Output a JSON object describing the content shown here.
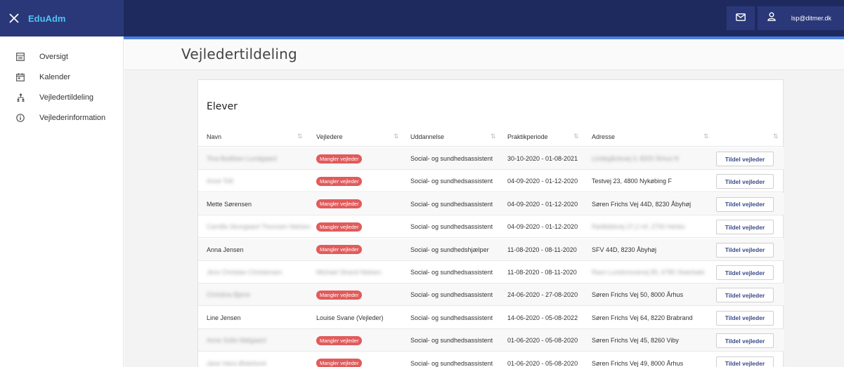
{
  "app": {
    "brand": "EduAdm",
    "user_email": "lsp@ditmer.dk"
  },
  "icons": {
    "close": "close-icon",
    "mail": "mail-icon",
    "user": "user-icon"
  },
  "colors": {
    "topbar": "#1e2a5e",
    "accent": "#4a7fe0",
    "brand": "#4fc3f7",
    "badge": "#e15b5b"
  },
  "sidebar": {
    "items": [
      {
        "label": "Oversigt",
        "icon": "overview-icon"
      },
      {
        "label": "Kalender",
        "icon": "calendar-icon"
      },
      {
        "label": "Vejledertildeling",
        "icon": "hierarchy-icon"
      },
      {
        "label": "Vejlederinformation",
        "icon": "info-icon"
      }
    ]
  },
  "page": {
    "title": "Vejledertildeling"
  },
  "card": {
    "title": "Elever",
    "columns": [
      "Navn",
      "Vejledere",
      "Uddannelse",
      "Praktikperiode",
      "Adresse",
      ""
    ],
    "assign_label": "Tildel vejleder",
    "badge_label": "Mangler vejleder",
    "rows": [
      {
        "name": "Tina Bodilsen Lundgaard",
        "name_blur": true,
        "advisor": "Mangler vejleder",
        "advisor_badge": true,
        "education": "Social- og sundhedsassistent",
        "period": "30-10-2020 - 01-08-2021",
        "address": "Lindegårdsvej 3, 8200 Århus N",
        "address_blur": true
      },
      {
        "name": "Anne Toft",
        "name_blur": true,
        "advisor": "Mangler vejleder",
        "advisor_badge": true,
        "education": "Social- og sundhedsassistent",
        "period": "04-09-2020 - 01-12-2020",
        "address": "Testvej 23, 4800 Nykøbing F",
        "address_blur": false
      },
      {
        "name": "Mette Sørensen",
        "name_blur": false,
        "advisor": "Mangler vejleder",
        "advisor_badge": true,
        "education": "Social- og sundhedsassistent",
        "period": "04-09-2020 - 01-12-2020",
        "address": "Søren Frichs Vej 44D, 8230 Åbyhøj",
        "address_blur": false
      },
      {
        "name": "Camilla Skovgaard Thomsen Nielsen",
        "name_blur": true,
        "advisor": "Mangler vejleder",
        "advisor_badge": true,
        "education": "Social- og sundhedsassistent",
        "period": "04-09-2020 - 01-12-2020",
        "address": "Rødkildevej 27,2 mf, 2700 Herlev",
        "address_blur": true
      },
      {
        "name": "Anna Jensen",
        "name_blur": false,
        "advisor": "Mangler vejleder",
        "advisor_badge": true,
        "education": "Social- og sundhedshjælper",
        "period": "11-08-2020 - 08-11-2020",
        "address": "SFV 44D, 8230 Åbyhøj",
        "address_blur": false
      },
      {
        "name": "Jens Christian Christensen",
        "name_blur": true,
        "advisor": "Michael Strand Nielsen",
        "advisor_badge": false,
        "advisor_blur": true,
        "education": "Social- og sundhedsassistent",
        "period": "11-08-2020 - 08-11-2020",
        "address": "Ravn Lundsmosevej 85, 6780 Skærbæk",
        "address_blur": true
      },
      {
        "name": "Christina Bjerre",
        "name_blur": true,
        "advisor": "Mangler vejleder",
        "advisor_badge": true,
        "education": "Social- og sundhedsassistent",
        "period": "24-06-2020 - 27-08-2020",
        "address": "Søren Frichs Vej 50, 8000 Århus",
        "address_blur": false
      },
      {
        "name": "Line Jensen",
        "name_blur": false,
        "advisor": "Louise Svane (Vejleder)",
        "advisor_badge": false,
        "advisor_blur": false,
        "education": "Social- og sundhedsassistent",
        "period": "14-06-2020 - 05-08-2022",
        "address": "Søren Frichs Vej 64, 8220 Brabrand",
        "address_blur": false
      },
      {
        "name": "Anne Sofie Mølgaard",
        "name_blur": true,
        "advisor": "Mangler vejleder",
        "advisor_badge": true,
        "education": "Social- og sundhedsassistent",
        "period": "01-06-2020 - 05-08-2020",
        "address": "Søren Frichs Vej 45, 8260 Viby",
        "address_blur": false
      },
      {
        "name": "Jane Hans Østerlund",
        "name_blur": true,
        "advisor": "Mangler vejleder",
        "advisor_badge": true,
        "education": "Social- og sundhedsassistent",
        "period": "01-06-2020 - 05-08-2020",
        "address": "Søren Frichs Vej 49, 8000 Århus",
        "address_blur": false
      }
    ]
  }
}
